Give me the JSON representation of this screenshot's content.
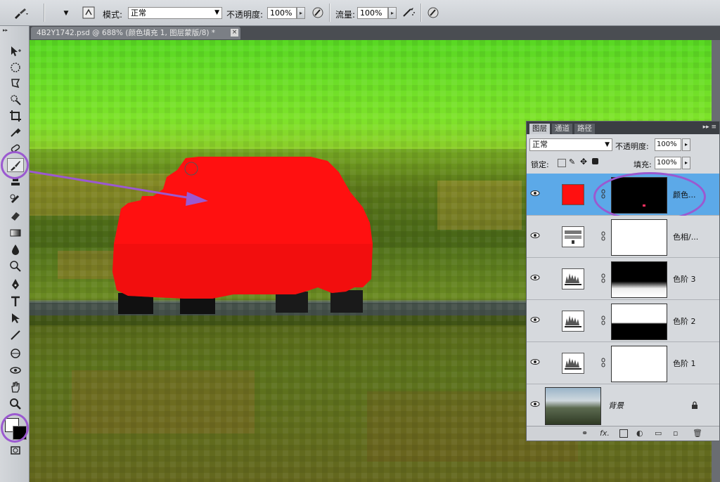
{
  "options_bar": {
    "tool_icon": "brush-icon",
    "brush_size": "",
    "mode_label": "模式:",
    "mode_value": "正常",
    "opacity_label": "不透明度:",
    "opacity_value": "100%",
    "flow_label": "流量:",
    "flow_value": "100%"
  },
  "document_tab": {
    "title": "4B2Y1742.psd @ 688% (颜色填充 1, 图层蒙版/8) *",
    "close": "×"
  },
  "layers_panel": {
    "tabs": [
      "图层",
      "通道",
      "路径"
    ],
    "menu": "▸▸ ≡",
    "blend_mode": "正常",
    "opacity_label": "不透明度:",
    "opacity_value": "100%",
    "lock_label": "锁定:",
    "fill_label": "填充:",
    "fill_value": "100%",
    "layers": [
      {
        "name": "颜色...",
        "type": "color-fill",
        "selected": true
      },
      {
        "name": "色相/...",
        "type": "hue-saturation",
        "selected": false
      },
      {
        "name": "色阶 3",
        "type": "levels",
        "selected": false
      },
      {
        "name": "色阶 2",
        "type": "levels",
        "selected": false
      },
      {
        "name": "色阶 1",
        "type": "levels",
        "selected": false
      },
      {
        "name": "背景",
        "type": "background",
        "selected": false
      }
    ],
    "bottom_icons": [
      "link-icon",
      "fx-icon",
      "mask-icon",
      "adjustment-icon",
      "group-icon",
      "new-layer-icon",
      "trash-icon"
    ]
  },
  "colors": {
    "fill_red": "#ff1010",
    "highlight_purple": "#9b59d0",
    "selected_layer": "#5ca9e8"
  }
}
